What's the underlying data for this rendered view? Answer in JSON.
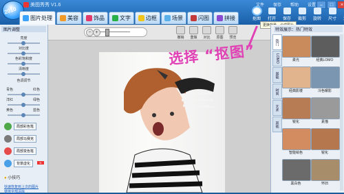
{
  "app": {
    "title": "美图秀秀 V1.6",
    "logo_text": "2010"
  },
  "tabs": [
    {
      "label": "图片处理",
      "icon": "picture-icon",
      "color": "#3aa3ff"
    },
    {
      "label": "美容",
      "icon": "face-icon",
      "color": "#f09a2a"
    },
    {
      "label": "饰品",
      "icon": "heart-icon",
      "color": "#e23a6a"
    },
    {
      "label": "文字",
      "icon": "text-icon",
      "color": "#2ab04a"
    },
    {
      "label": "边框",
      "icon": "frame-icon",
      "color": "#f2c51b"
    },
    {
      "label": "场景",
      "icon": "scene-icon",
      "color": "#5bb0ea"
    },
    {
      "label": "闪图",
      "icon": "flash-icon",
      "color": "#c33a3a"
    },
    {
      "label": "拼接",
      "icon": "puzzle-icon",
      "color": "#8a4bd0"
    }
  ],
  "menu": [
    "文件",
    "保存",
    "帮助",
    "设置"
  ],
  "toolbar": [
    {
      "label": "抠图",
      "icon": "scissors-icon"
    },
    {
      "label": "打开",
      "icon": "folder-icon"
    },
    {
      "label": "保存",
      "icon": "save-icon"
    },
    {
      "label": "裁剪",
      "icon": "crop-icon"
    },
    {
      "label": "旋转",
      "icon": "rotate-icon"
    },
    {
      "label": "尺寸",
      "icon": "resize-icon"
    },
    {
      "label": "涂鸦",
      "icon": "brush-icon"
    }
  ],
  "left_panel": {
    "header": "图片调整",
    "sliders": [
      {
        "label": "亮度",
        "level": 0.5
      },
      {
        "label": "对比度",
        "level": 0.5
      },
      {
        "label": "色彩饱和度",
        "level": 0.5
      },
      {
        "label": "清晰度",
        "level": 0.5
      }
    ],
    "color_header": "色调调节",
    "color_sliders": [
      {
        "left": "青色",
        "right": "红色",
        "level": 0.5
      },
      {
        "left": "洋红",
        "right": "绿色",
        "level": 0.5
      },
      {
        "left": "黄色",
        "right": "蓝色",
        "level": 0.5
      }
    ],
    "buttons": [
      {
        "label": "局部彩色笔",
        "color": "#4ea84a"
      },
      {
        "label": "局部马赛克",
        "color": "#7a7a7a"
      },
      {
        "label": "局部变色笔",
        "color": "#e64a4a"
      },
      {
        "label": "背景虚化",
        "color": "#4aa0e6"
      }
    ],
    "tip_title": "小技巧",
    "tip_links": [
      "快速恢复到上次的图片",
      "使用全部清除"
    ]
  },
  "canvas_tools": [
    {
      "label": "撤销",
      "icon": "undo-icon"
    },
    {
      "label": "重做",
      "icon": "redo-icon"
    },
    {
      "label": "对比",
      "icon": "compare-icon"
    },
    {
      "label": "原图",
      "icon": "original-icon"
    },
    {
      "label": "预览",
      "icon": "preview-icon"
    }
  ],
  "annotation": "选择 “抠图”",
  "tooltip": "更换背景，合成图片",
  "right_panel": {
    "header": "特效展示：热门特效",
    "vtabs": [
      "热门",
      "LOMO",
      "基础",
      "时尚",
      "艺术",
      "其他"
    ],
    "effects": [
      {
        "label": "柔光",
        "tone": "#c98a5c"
      },
      {
        "label": "经典LOMO",
        "tone": "#5d5d5d"
      },
      {
        "label": "经典影楼",
        "tone": "#e2b48d"
      },
      {
        "label": "冷色暖影",
        "tone": "#7a96b0"
      },
      {
        "label": "锐化",
        "tone": "#b87c55"
      },
      {
        "label": "素描",
        "tone": "#9a9a9a"
      },
      {
        "label": "智能绘色",
        "tone": "#d38c60"
      },
      {
        "label": "锐化",
        "tone": "#b5784e"
      },
      {
        "label": "黑白色",
        "tone": "#6b6b6b"
      },
      {
        "label": "怀旧",
        "tone": "#a88d6a"
      }
    ]
  }
}
